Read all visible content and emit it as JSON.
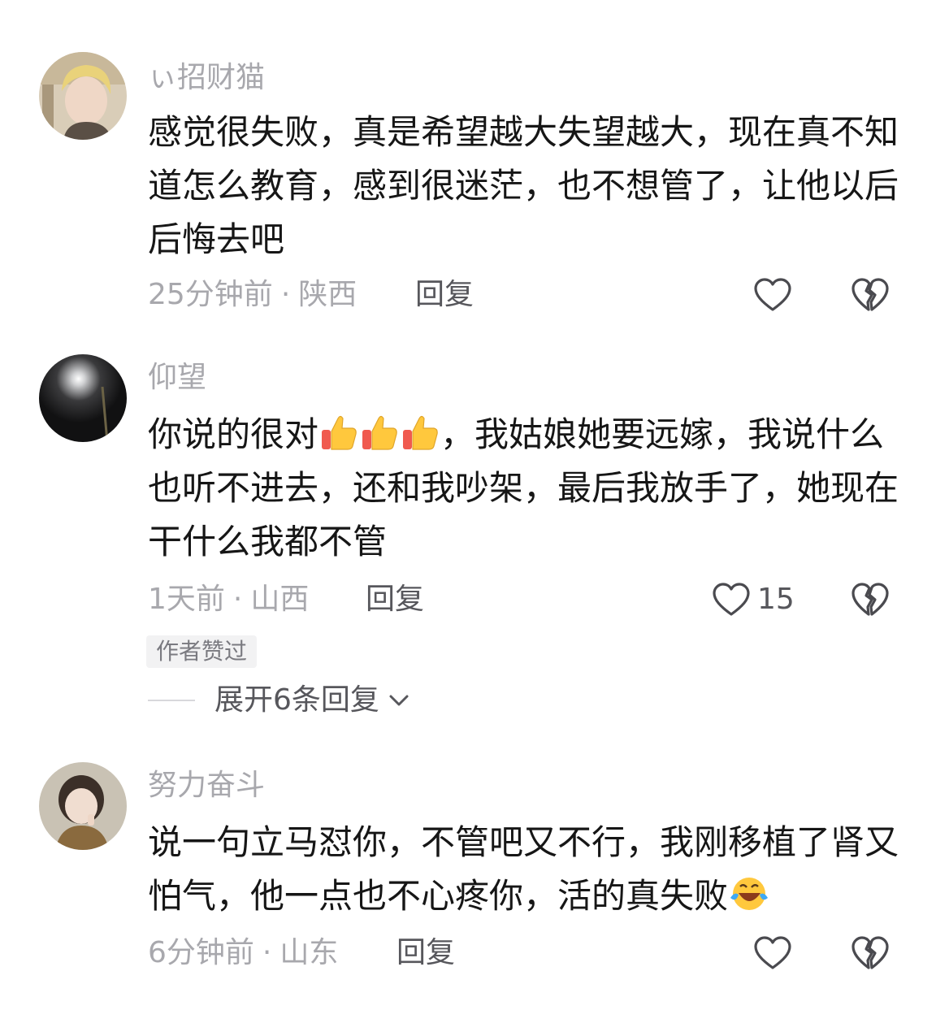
{
  "comments": [
    {
      "username": "ぃ招财猫",
      "text": "感觉很失败，真是希望越大失望越大，现在真不知道怎么教育，感到很迷茫，也不想管了，让他以后后悔去吧",
      "time": "25分钟前",
      "location": "陕西",
      "reply_label": "回复",
      "avatar_icon": "avatar-short-hair-person-icon"
    },
    {
      "username": "仰望",
      "text_before": "你说的很对",
      "text_after": "，我姑娘她要远嫁，我说什么也听不进去，还和我吵架，最后我放手了，她现在干什么我都不管",
      "emojis": [
        "thumbs-up-icon",
        "thumbs-up-icon",
        "thumbs-up-icon"
      ],
      "time": "1天前",
      "location": "山西",
      "reply_label": "回复",
      "like_count": "15",
      "author_badge": "作者赞过",
      "expand_label": "展开6条回复",
      "avatar_icon": "avatar-night-light-icon"
    },
    {
      "username": "努力奋斗",
      "text": "说一句立马怼你，不管吧又不行，我刚移植了肾又怕气，他一点也不心疼你，活的真失败",
      "emoji": "face-with-tears-of-joy-icon",
      "time": "6分钟前",
      "location": "山东",
      "reply_label": "回复",
      "avatar_icon": "avatar-child-icon"
    }
  ],
  "separator": "·",
  "colors": {
    "username": "#a8a8ad",
    "text": "#161616",
    "meta": "#a8a8ad",
    "action": "#57575c"
  }
}
